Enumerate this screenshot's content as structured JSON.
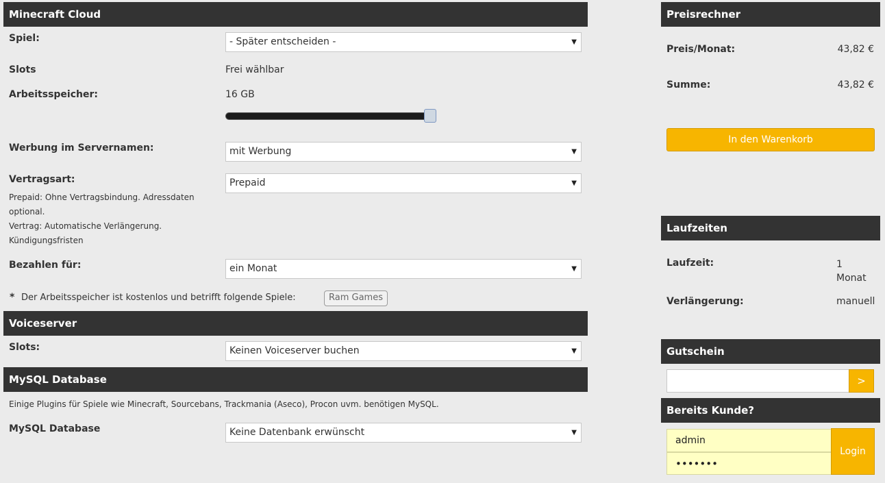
{
  "minecraft": {
    "header": "Minecraft Cloud",
    "spiel_label": "Spiel:",
    "spiel_value": "- Später entscheiden -",
    "slots_label": "Slots",
    "slots_value": "Frei wählbar",
    "ram_label": "Arbeitsspeicher:",
    "ram_value": "16 GB",
    "ram_slider_level": 1.0,
    "werbung_label": "Werbung im Servernamen:",
    "werbung_value": "mit Werbung",
    "vertrag_label": "Vertragsart:",
    "vertrag_value": "Prepaid",
    "vertrag_note_1": "Prepaid: Ohne Vertragsbindung. Adressdaten",
    "vertrag_note_2": "optional.",
    "vertrag_note_3": "Vertrag: Automatische Verlängerung.",
    "vertrag_note_4": "Kündigungsfristen",
    "bezahlen_label": "Bezahlen für:",
    "bezahlen_value": "ein Monat",
    "note_star": "*",
    "note_text": "Der Arbeitsspeicher ist kostenlos und betrifft folgende Spiele:",
    "note_tag": "Ram Games"
  },
  "voiceserver": {
    "header": "Voiceserver",
    "slots_label": "Slots:",
    "slots_value": "Keinen Voiceserver buchen"
  },
  "mysql": {
    "header": "MySQL Database",
    "description": "Einige Plugins für Spiele wie Minecraft, Sourcebans, Trackmania (Aseco), Procon uvm. benötigen MySQL.",
    "label": "MySQL Database",
    "value": "Keine Datenbank erwünscht"
  },
  "preisrechner": {
    "header": "Preisrechner",
    "preis_label": "Preis/Monat:",
    "preis_value": "43,82 €",
    "summe_label": "Summe:",
    "summe_value": "43,82 €",
    "cart_button": "In den Warenkorb"
  },
  "laufzeiten": {
    "header": "Laufzeiten",
    "laufzeit_label": "Laufzeit:",
    "laufzeit_value_1": "1",
    "laufzeit_value_2": "Monat",
    "verlaengerung_label": "Verlängerung:",
    "verlaengerung_value": "manuell"
  },
  "gutschein": {
    "header": "Gutschein",
    "input_value": "",
    "submit": ">"
  },
  "kunde": {
    "header": "Bereits Kunde?",
    "username": "admin",
    "password": "•••••••",
    "login_button": "Login"
  },
  "colors": {
    "header_bg": "#333333",
    "accent": "#f7b500",
    "input_highlight": "#ffffc4"
  },
  "icons": {
    "select_arrow": "▼"
  }
}
